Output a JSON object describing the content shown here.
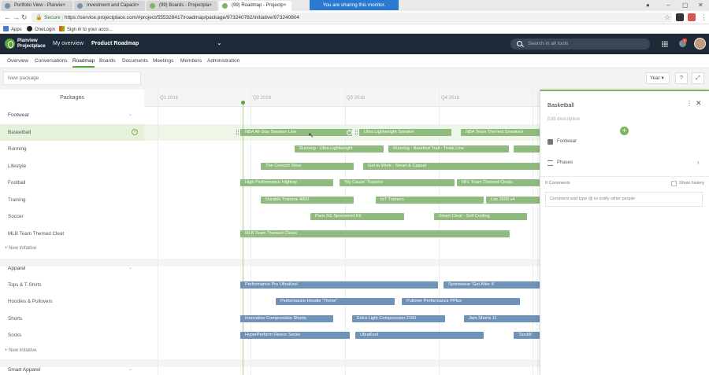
{
  "browser": {
    "tabs": [
      {
        "label": "Portfolio View - Planvie×"
      },
      {
        "label": "Investment and Capacit×"
      },
      {
        "label": "(99) Boards - Projectpla×"
      },
      {
        "label": "(99) Roadmap - Projectp×"
      }
    ],
    "sharing_banner": "You are sharing this monitor.",
    "secure_label": "Secure",
    "url": "https://service.projectplace.com/#project/555328417/roadmap/package/973240782/initiative/973240804",
    "bookmarks": [
      "Apps",
      "OneLogin",
      "Sign in to your acco..."
    ]
  },
  "app": {
    "logo_line1": "Planview",
    "logo_line2": "Projectplace",
    "nav_overview": "My overview",
    "project_name": "Product Roadmap",
    "search_placeholder": "Search in all tools",
    "notification_count": "2",
    "subnav": [
      "Overview",
      "Conversations",
      "Roadmap",
      "Boards",
      "Documents",
      "Meetings",
      "Members",
      "Administration"
    ],
    "active_subnav": "Roadmap"
  },
  "toolbar": {
    "new_package_placeholder": "New package",
    "view_select": "Year",
    "help_icon": "?",
    "expand_icon": "⤢"
  },
  "left": {
    "header": "Packages",
    "groups": [
      {
        "name": "Footwear",
        "items": [
          "Basketball",
          "Running",
          "Lifestyle",
          "Football",
          "Training",
          "Soccer",
          "MLB Team Themed Cleat"
        ],
        "new_initiative": "New initiative"
      },
      {
        "name": "Apparel",
        "items": [
          "Tops & T-Shirts",
          "Hoodies & Pullovers",
          "Shorts",
          "Socks"
        ],
        "new_initiative": "New initiative"
      },
      {
        "name": "Smart Apparel",
        "items": []
      }
    ]
  },
  "timeline": {
    "quarters": [
      "Q1 2018",
      "Q2 2018",
      "Q3 2018",
      "Q4 2018"
    ],
    "bars": {
      "basketball": [
        "NBA All-Star Sneaker Line",
        "Ultra Lightweight Sneaker",
        "NBA Team Themed Sneakers"
      ],
      "running": [
        "Running - Ultra Lightweight",
        "Running - Barefoot Trail - Trekk Line"
      ],
      "lifestyle": [
        "The Concert Shoe",
        "Get to Work - Smart & Casual"
      ],
      "football": [
        "High Performance Hightop",
        "'My Cause' Trainers",
        "NFL Team Themed Cleats"
      ],
      "training": [
        "Durable Trainers 4000",
        "IoT Trainers",
        "Lite 2600 v4"
      ],
      "soccer": [
        "Paris 5G Sponsored Kit",
        "Smart Cleat - Self Cooling"
      ],
      "mlb": [
        "MLB Team Themed Cleats"
      ],
      "tops": [
        "Performance Pro UltraKool",
        "Sportswear 'Get After It'"
      ],
      "hoodies": [
        "Performance Hoodie \"Thrive\"",
        "Pullover Performance PPlus"
      ],
      "shorts": [
        "Innovative Compression Shorts",
        "Extra Light Compression 2160",
        "Jam Shorts 11"
      ],
      "socks": [
        "HyperPerform Fleece Socks",
        "UltraKool",
        "'SockIt'"
      ]
    }
  },
  "panel": {
    "title": "Basketball",
    "description_placeholder": "Edit description",
    "package": "Footwear",
    "phases": "Phases",
    "comments": "0 Comments",
    "show_history": "Show history",
    "comment_placeholder": "Comment and type @ to notify other people"
  },
  "colors": {
    "header_bg": "#1e2a38",
    "accent_green": "#5aa83a",
    "bar_green": "#8fbb7e",
    "bar_blue": "#6f93b8",
    "sharing_blue": "#2b7ad1"
  }
}
